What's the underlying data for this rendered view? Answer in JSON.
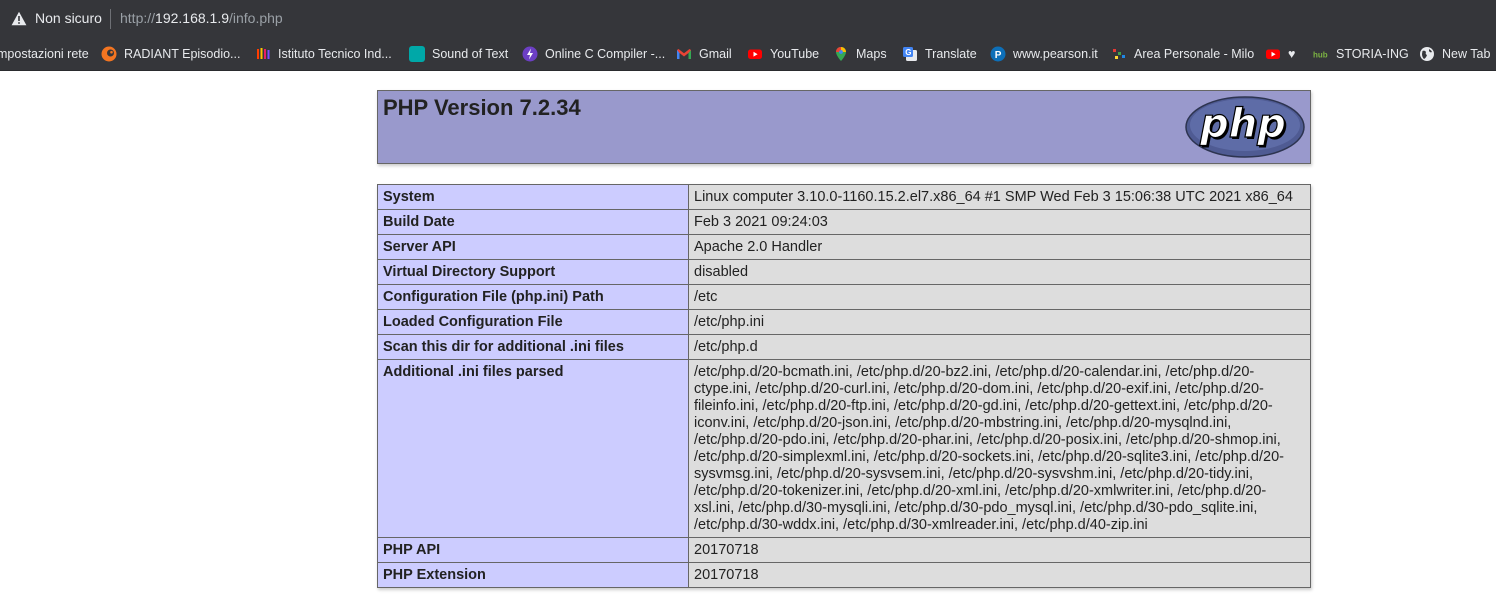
{
  "browser": {
    "security_label": "Non sicuro",
    "url_prefix": "http://",
    "url_host": "192.168.1.9",
    "url_path": "/info.php",
    "chrome_color": "#35363a"
  },
  "bookmarks": [
    {
      "label": "mpostazioni rete",
      "icon": "none",
      "color": "#35363a"
    },
    {
      "label": "RADIANT Episodio...",
      "icon": "crunchyroll-icon",
      "color": "#f47521"
    },
    {
      "label": "Istituto Tecnico Ind...",
      "icon": "school-icon",
      "color": "#e91e63"
    },
    {
      "label": "Sound of Text",
      "icon": "sound-of-text-icon",
      "color": "#00a8a8"
    },
    {
      "label": "Online C Compiler -...",
      "icon": "bolt-icon",
      "color": "#6c3fc4"
    },
    {
      "label": "Gmail",
      "icon": "gmail-icon",
      "color": "#ea4335"
    },
    {
      "label": "YouTube",
      "icon": "youtube-icon",
      "color": "#ff0000"
    },
    {
      "label": "Maps",
      "icon": "maps-icon",
      "color": "#34a853"
    },
    {
      "label": "Translate",
      "icon": "translate-icon",
      "color": "#4285f4"
    },
    {
      "label": "www.pearson.it",
      "icon": "pearson-icon",
      "color": "#0d6fb8"
    },
    {
      "label": "Area Personale - Milo",
      "icon": "milo-icon",
      "color": "#c0392b"
    },
    {
      "label": "♥",
      "icon": "youtube-icon",
      "color": "#ff0000"
    },
    {
      "label": "STORIA-ING",
      "icon": "hub-icon",
      "color": "#7cb342"
    },
    {
      "label": "New Tab",
      "icon": "globe-icon",
      "color": "#e8eaed"
    }
  ],
  "php": {
    "title": "PHP Version 7.2.34",
    "logo_text": "php",
    "header_color": "#9999cc",
    "label_bg": "#ccccff",
    "value_bg": "#dddddd"
  },
  "rows": [
    {
      "label": "System",
      "value": "Linux computer 3.10.0-1160.15.2.el7.x86_64 #1 SMP Wed Feb 3 15:06:38 UTC 2021 x86_64"
    },
    {
      "label": "Build Date",
      "value": "Feb 3 2021 09:24:03"
    },
    {
      "label": "Server API",
      "value": "Apache 2.0 Handler"
    },
    {
      "label": "Virtual Directory Support",
      "value": "disabled"
    },
    {
      "label": "Configuration File (php.ini) Path",
      "value": "/etc"
    },
    {
      "label": "Loaded Configuration File",
      "value": "/etc/php.ini"
    },
    {
      "label": "Scan this dir for additional .ini files",
      "value": "/etc/php.d"
    },
    {
      "label": "Additional .ini files parsed",
      "value": "/etc/php.d/20-bcmath.ini, /etc/php.d/20-bz2.ini, /etc/php.d/20-calendar.ini, /etc/php.d/20-ctype.ini, /etc/php.d/20-curl.ini, /etc/php.d/20-dom.ini, /etc/php.d/20-exif.ini, /etc/php.d/20-fileinfo.ini, /etc/php.d/20-ftp.ini, /etc/php.d/20-gd.ini, /etc/php.d/20-gettext.ini, /etc/php.d/20-iconv.ini, /etc/php.d/20-json.ini, /etc/php.d/20-mbstring.ini, /etc/php.d/20-mysqlnd.ini, /etc/php.d/20-pdo.ini, /etc/php.d/20-phar.ini, /etc/php.d/20-posix.ini, /etc/php.d/20-shmop.ini, /etc/php.d/20-simplexml.ini, /etc/php.d/20-sockets.ini, /etc/php.d/20-sqlite3.ini, /etc/php.d/20-sysvmsg.ini, /etc/php.d/20-sysvsem.ini, /etc/php.d/20-sysvshm.ini, /etc/php.d/20-tidy.ini, /etc/php.d/20-tokenizer.ini, /etc/php.d/20-xml.ini, /etc/php.d/20-xmlwriter.ini, /etc/php.d/20-xsl.ini, /etc/php.d/30-mysqli.ini, /etc/php.d/30-pdo_mysql.ini, /etc/php.d/30-pdo_sqlite.ini, /etc/php.d/30-wddx.ini, /etc/php.d/30-xmlreader.ini, /etc/php.d/40-zip.ini"
    },
    {
      "label": "PHP API",
      "value": "20170718"
    },
    {
      "label": "PHP Extension",
      "value": "20170718"
    }
  ]
}
